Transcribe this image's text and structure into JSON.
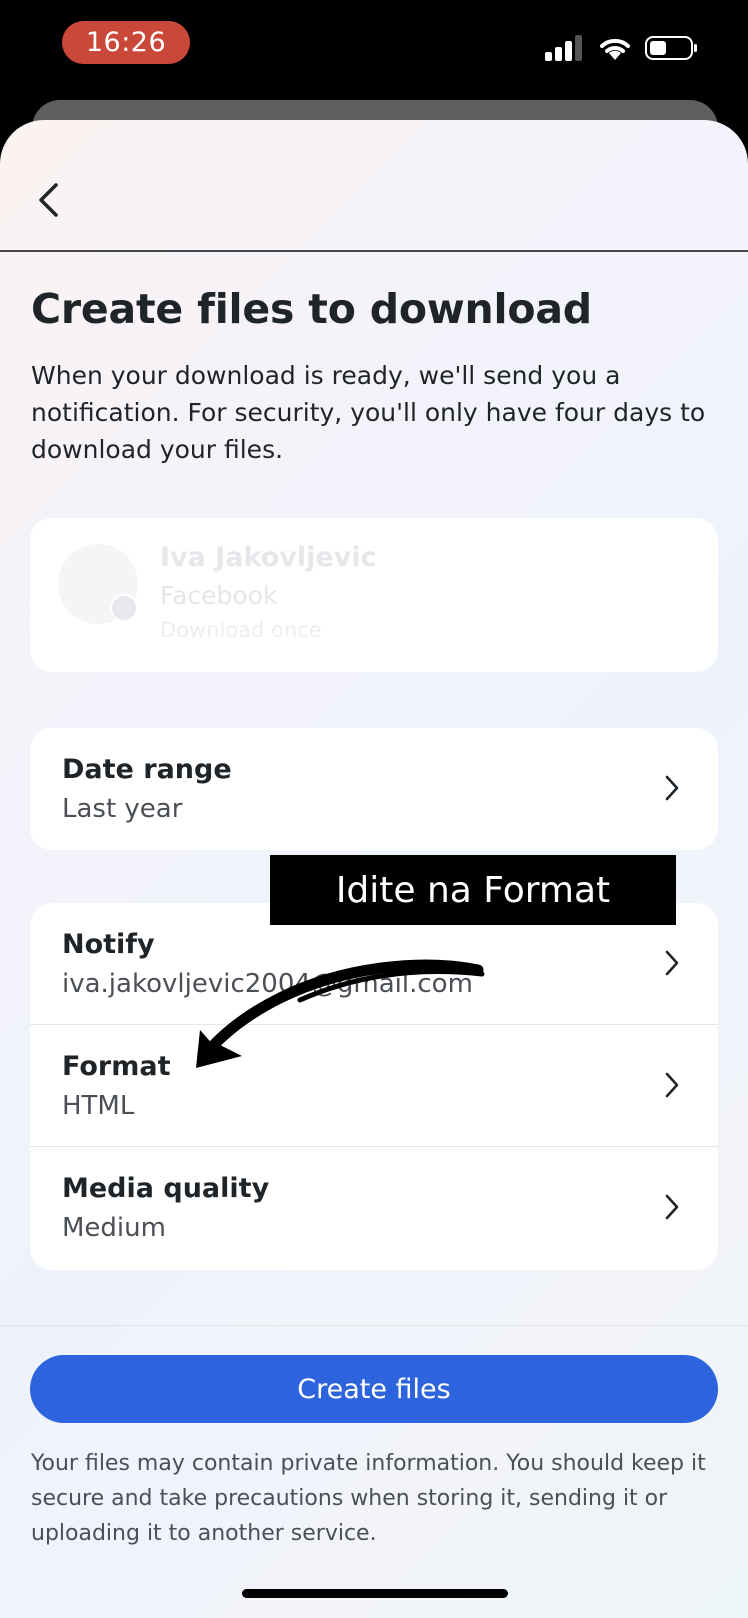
{
  "status_bar": {
    "time": "16:26",
    "icons": [
      "signal-icon",
      "wifi-icon",
      "battery-icon"
    ]
  },
  "header": {
    "back_icon": "chevron-left-icon"
  },
  "page": {
    "title": "Create files to download",
    "description": "When your download is ready, we'll send you a notification. For security, you'll only have four days to download your files."
  },
  "account_card": {
    "name": "Iva Jakovljevic",
    "app": "Facebook",
    "mode": "Download once"
  },
  "date_range": {
    "label": "Date range",
    "value": "Last year"
  },
  "settings": {
    "notify": {
      "label": "Notify",
      "value": "iva.jakovljevic2004@gmail.com"
    },
    "format": {
      "label": "Format",
      "value": "HTML"
    },
    "media_quality": {
      "label": "Media quality",
      "value": "Medium"
    }
  },
  "annotation": {
    "text": "Idite na Format"
  },
  "footer": {
    "button_label": "Create files",
    "disclaimer": "Your files may contain private information. You should keep it secure and take precautions when storing it, sending it or uploading it to another service."
  },
  "colors": {
    "primary": "#2d64dd",
    "time_pill": "#c9483a",
    "text": "#1f2429",
    "secondary_text": "#4b4f56"
  }
}
